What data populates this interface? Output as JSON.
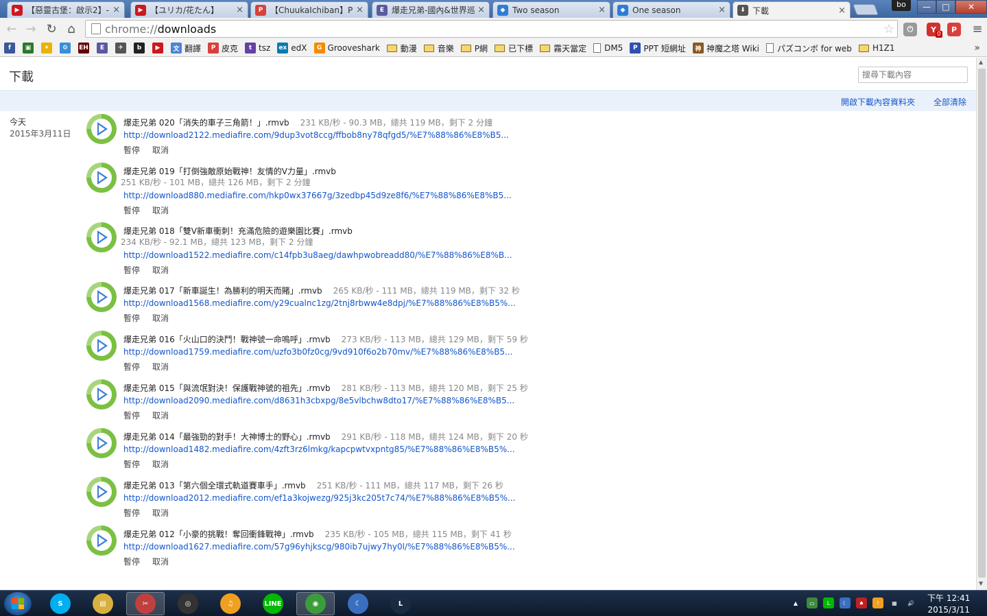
{
  "tabs": [
    {
      "title": "【惡靈古堡：啟示2】-",
      "favicon": "youtube-icon",
      "color": "#cc181e"
    },
    {
      "title": "【ユリカ/花たん】",
      "favicon": "youtube-icon",
      "color": "#cc181e"
    },
    {
      "title": "【ChuukaIchiban】Pi",
      "favicon": "pixiv-icon",
      "color": "#d8403b"
    },
    {
      "title": "爆走兄弟-國內&世界巡",
      "favicon": "page-icon",
      "color": "#5a5aa0"
    },
    {
      "title": "Two season",
      "favicon": "hash-icon",
      "color": "#2f7bd6"
    },
    {
      "title": "One season",
      "favicon": "hash-icon",
      "color": "#2f7bd6"
    },
    {
      "title": "下載",
      "favicon": "download-icon",
      "color": "#555555"
    }
  ],
  "window": {
    "profile": "bo",
    "minimize": "—",
    "maximize": "□",
    "close": "✕"
  },
  "omnibox": {
    "url_scheme": "chrome://",
    "url_path": "downloads"
  },
  "extensions": [
    {
      "name": "power-icon",
      "label": "⏻",
      "color": "#999999"
    },
    {
      "name": "yahoo-mail-icon",
      "label": "Y",
      "color": "#d03030",
      "badge": "0"
    },
    {
      "name": "pocket-icon",
      "label": "P",
      "color": "#d8403b"
    }
  ],
  "bookmarks": [
    {
      "label": "",
      "type": "icon",
      "icon": "facebook-icon",
      "color": "#3b5998",
      "glyph": "f"
    },
    {
      "label": "",
      "type": "icon",
      "icon": "game-icon",
      "color": "#2a7a2a",
      "glyph": "▣"
    },
    {
      "label": "",
      "type": "icon",
      "icon": "star-icon",
      "color": "#e8b400",
      "glyph": "✶"
    },
    {
      "label": "",
      "type": "icon",
      "icon": "swirl-icon",
      "color": "#3a8ed8",
      "glyph": "⚙"
    },
    {
      "label": "",
      "type": "icon",
      "icon": "eh-icon",
      "color": "#660000",
      "glyph": "EH"
    },
    {
      "label": "",
      "type": "icon",
      "icon": "e-icon",
      "color": "#5a5aa0",
      "glyph": "E"
    },
    {
      "label": "",
      "type": "icon",
      "icon": "bird-icon",
      "color": "#555555",
      "glyph": "✈"
    },
    {
      "label": "",
      "type": "icon",
      "icon": "b-icon",
      "color": "#222222",
      "glyph": "b"
    },
    {
      "label": "",
      "type": "icon",
      "icon": "youtube-icon",
      "color": "#cc181e",
      "glyph": "▶"
    },
    {
      "label": "翻譯",
      "type": "icon",
      "icon": "translate-icon",
      "color": "#4a84d8",
      "glyph": "文"
    },
    {
      "label": "皮克",
      "type": "icon",
      "icon": "pixiv-icon",
      "color": "#d8403b",
      "glyph": "P"
    },
    {
      "label": "tsz",
      "type": "icon",
      "icon": "twitch-icon",
      "color": "#6441a5",
      "glyph": "t"
    },
    {
      "label": "edX",
      "type": "icon",
      "icon": "edx-icon",
      "color": "#0b7ab0",
      "glyph": "ex"
    },
    {
      "label": "Grooveshark",
      "type": "icon",
      "icon": "grooveshark-icon",
      "color": "#f28c00",
      "glyph": "G"
    },
    {
      "label": "動漫",
      "type": "folder"
    },
    {
      "label": "音樂",
      "type": "folder"
    },
    {
      "label": "P網",
      "type": "folder"
    },
    {
      "label": "已下標",
      "type": "folder"
    },
    {
      "label": "霧天當定",
      "type": "folder"
    },
    {
      "label": "DM5",
      "type": "page"
    },
    {
      "label": "PPT 短網址",
      "type": "icon",
      "icon": "ppt-icon",
      "color": "#3050b0",
      "glyph": "P"
    },
    {
      "label": "神魔之塔 Wiki",
      "type": "icon",
      "icon": "tos-icon",
      "color": "#8a5a20",
      "glyph": "神"
    },
    {
      "label": "パズコンボ for web",
      "type": "page"
    },
    {
      "label": "H1Z1",
      "type": "folder"
    }
  ],
  "bookmarks_more": "»",
  "page": {
    "title": "下載",
    "search_placeholder": "搜尋下載內容",
    "open_folder": "開啟下載內容資料夾",
    "clear_all": "全部清除",
    "date_label": "今天",
    "date_full": "2015年3月11日"
  },
  "downloads": [
    {
      "name": "爆走兄弟 020「消失的車子三角箭！」.rmvb",
      "status": "231 KB/秒 - 90.3 MB，總共 119 MB，剩下 2 分鐘",
      "status_wrap": false,
      "url": "http://download2122.mediafire.com/9dup3vot8ccg/ffbob8ny78qfgd5/%E7%88%86%E8%B5...",
      "pause": "暫停",
      "cancel": "取消"
    },
    {
      "name": "爆走兄弟 019「打倒強敵原始戰神！友情的V力量」.rmvb",
      "status": "251 KB/秒 - 101 MB，總共 126 MB，剩下 2 分鐘",
      "status_wrap": true,
      "url": "http://download880.mediafire.com/hkp0wx37667g/3zedbp45d9ze8f6/%E7%88%86%E8%B5...",
      "pause": "暫停",
      "cancel": "取消"
    },
    {
      "name": "爆走兄弟 018「雙V新車衝刺！充滿危險的遊樂園比賽」.rmvb",
      "status": "234 KB/秒 - 92.1 MB，總共 123 MB，剩下 2 分鐘",
      "status_wrap": true,
      "url": "http://download1522.mediafire.com/c14fpb3u8aeg/dawhpwobreadd80/%E7%88%86%E8%B...",
      "pause": "暫停",
      "cancel": "取消"
    },
    {
      "name": "爆走兄弟 017「新車誕生！為勝利的明天而賭」.rmvb",
      "status": "265 KB/秒 - 111 MB，總共 119 MB，剩下 32 秒",
      "status_wrap": false,
      "url": "http://download1568.mediafire.com/y29cualnc1zg/2tnj8rbww4e8dpj/%E7%88%86%E8%B5%...",
      "pause": "暫停",
      "cancel": "取消"
    },
    {
      "name": "爆走兄弟 016「火山口的決鬥！戰神號一命嗚呼」.rmvb",
      "status": "273 KB/秒 - 113 MB，總共 129 MB，剩下 59 秒",
      "status_wrap": false,
      "url": "http://download1759.mediafire.com/uzfo3b0fz0cg/9vd910f6o2b70mv/%E7%88%86%E8%B5...",
      "pause": "暫停",
      "cancel": "取消"
    },
    {
      "name": "爆走兄弟 015「與流氓對決！保護戰神號的祖先」.rmvb",
      "status": "281 KB/秒 - 113 MB，總共 120 MB，剩下 25 秒",
      "status_wrap": false,
      "url": "http://download2090.mediafire.com/d8631h3cbxpg/8e5vlbchw8dto17/%E7%88%86%E8%B5...",
      "pause": "暫停",
      "cancel": "取消"
    },
    {
      "name": "爆走兄弟 014「最強勁的對手！大神博士的野心」.rmvb",
      "status": "291 KB/秒 - 118 MB，總共 124 MB，剩下 20 秒",
      "status_wrap": false,
      "url": "http://download1482.mediafire.com/4zft3rz6lmkg/kapcpwtvxpntg85/%E7%88%86%E8%B5%...",
      "pause": "暫停",
      "cancel": "取消"
    },
    {
      "name": "爆走兄弟 013「第六個全環式軌道賽車手」.rmvb",
      "status": "251 KB/秒 - 111 MB，總共 117 MB，剩下 26 秒",
      "status_wrap": false,
      "url": "http://download2012.mediafire.com/ef1a3kojwezg/925j3kc205t7c74/%E7%88%86%E8%B5%...",
      "pause": "暫停",
      "cancel": "取消"
    },
    {
      "name": "爆走兄弟 012「小豪的挑戰！奪回衝鋒戰神」.rmvb",
      "status": "235 KB/秒 - 105 MB，總共 115 MB，剩下 41 秒",
      "status_wrap": false,
      "url": "http://download1627.mediafire.com/57g96yhjkscg/980ib7ujwy7hy0l/%E7%88%86%E8%B5%...",
      "pause": "暫停",
      "cancel": "取消"
    }
  ],
  "taskbar": {
    "apps": [
      {
        "name": "skype-icon",
        "glyph": "S",
        "color": "#00aff0",
        "active": false
      },
      {
        "name": "file-explorer-icon",
        "glyph": "▤",
        "color": "#d8b040",
        "active": false
      },
      {
        "name": "scissors-tool-icon",
        "glyph": "✂",
        "color": "#c04040",
        "active": true
      },
      {
        "name": "spiral-app-icon",
        "glyph": "◎",
        "color": "#333333",
        "active": false
      },
      {
        "name": "headphones-app-icon",
        "glyph": "♫",
        "color": "#f0a020",
        "active": false
      },
      {
        "name": "line-icon",
        "glyph": "LINE",
        "color": "#00b900",
        "active": false
      },
      {
        "name": "chrome-icon",
        "glyph": "◉",
        "color": "#3a9d3a",
        "active": true
      },
      {
        "name": "moon-app-icon",
        "glyph": "☾",
        "color": "#3a6fc0",
        "active": false
      },
      {
        "name": "league-icon",
        "glyph": "L",
        "color": "#1a2a40",
        "active": false
      }
    ],
    "tray_icons": [
      {
        "name": "show-hidden-icon",
        "glyph": "▲",
        "color": "transparent"
      },
      {
        "name": "battery-icon",
        "glyph": "▭",
        "color": "#3c8a3c"
      },
      {
        "name": "line-tray-icon",
        "glyph": "L",
        "color": "#00b900"
      },
      {
        "name": "moon-tray-icon",
        "glyph": "☾",
        "color": "#3a6fc0"
      },
      {
        "name": "red-tray-icon",
        "glyph": "♠",
        "color": "#c02020"
      },
      {
        "name": "orange-tray-icon",
        "glyph": "!",
        "color": "#f0a020"
      },
      {
        "name": "network-icon",
        "glyph": "▦",
        "color": "transparent"
      },
      {
        "name": "volume-icon",
        "glyph": "🔊",
        "color": "transparent"
      }
    ],
    "time": "下午 12:41",
    "date": "2015/3/11"
  }
}
